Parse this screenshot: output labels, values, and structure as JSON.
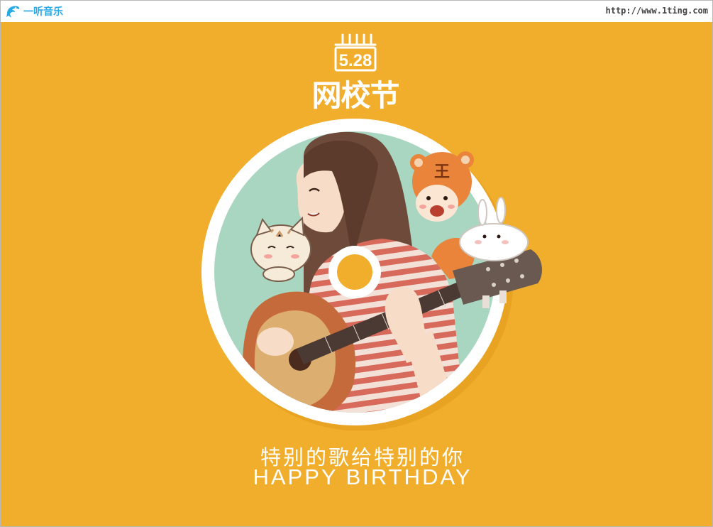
{
  "header": {
    "brand_name": "一听音乐",
    "url": "http://www.1ting.com",
    "logo_icon": "dolphin-icon"
  },
  "poster": {
    "date": "5.28",
    "festival_title": "网校节",
    "slogan_cn": "特别的歌给特别的你",
    "slogan_en": "HAPPY BIRTHDAY",
    "illustration": "girl-with-guitar-cd-illustration"
  },
  "colors": {
    "background": "#f1ae2c",
    "brand_blue": "#27a9e6",
    "disc_inner": "#a9d6c0",
    "text_white": "#ffffff"
  }
}
